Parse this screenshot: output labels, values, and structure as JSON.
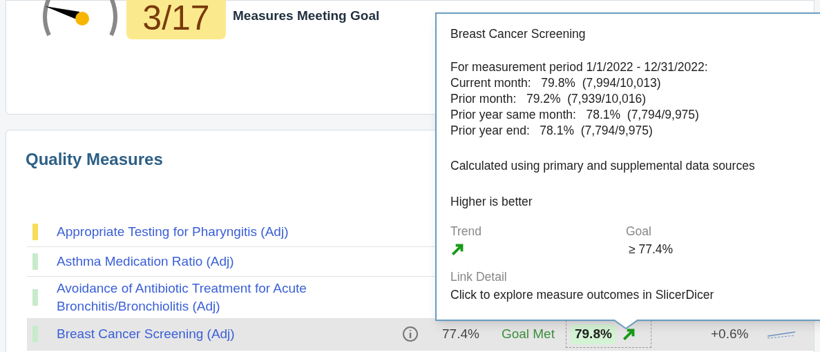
{
  "summary": {
    "score": "3/17",
    "label": "Measures Meeting Goal"
  },
  "quality": {
    "title": "Quality Measures",
    "rows": [
      {
        "name": "Appropriate Testing for Pharyngitis (Adj)",
        "color": "#f8dc5a",
        "selected": false
      },
      {
        "name": "Asthma Medication Ratio (Adj)",
        "color": "#c8ebcb",
        "selected": false
      },
      {
        "name": "Avoidance of Antibiotic Treatment for Acute Bronchitis/Bronchiolitis (Adj)",
        "color": "#c8ebcb",
        "selected": false
      },
      {
        "name": "Breast Cancer Screening (Adj)",
        "color": "#c8ebcb",
        "selected": true,
        "goal": "77.4%",
        "status": "Goal Met",
        "current": "79.8%",
        "trend": {
          "kind": "up"
        },
        "change": "+0.6%"
      }
    ]
  },
  "tooltip": {
    "title": "Breast Cancer Screening",
    "lines": [
      "For measurement period 1/1/2022 - 12/31/2022:",
      "Current month:   79.8%  (7,994/10,013)",
      "Prior month:   79.2%  (7,939/10,016)",
      "Prior year same month:   78.1%  (7,794/9,975)",
      "Prior year end:   78.1%  (7,794/9,975)"
    ],
    "source": "Calculated using primary and supplemental data sources",
    "direction": "Higher is better",
    "trend_label": "Trend",
    "trend": {
      "kind": "up"
    },
    "goal_label": "Goal",
    "goal": "≥ 77.4%",
    "link_label": "Link Detail",
    "link_text": "Click to explore measure outcomes in SlicerDicer"
  }
}
